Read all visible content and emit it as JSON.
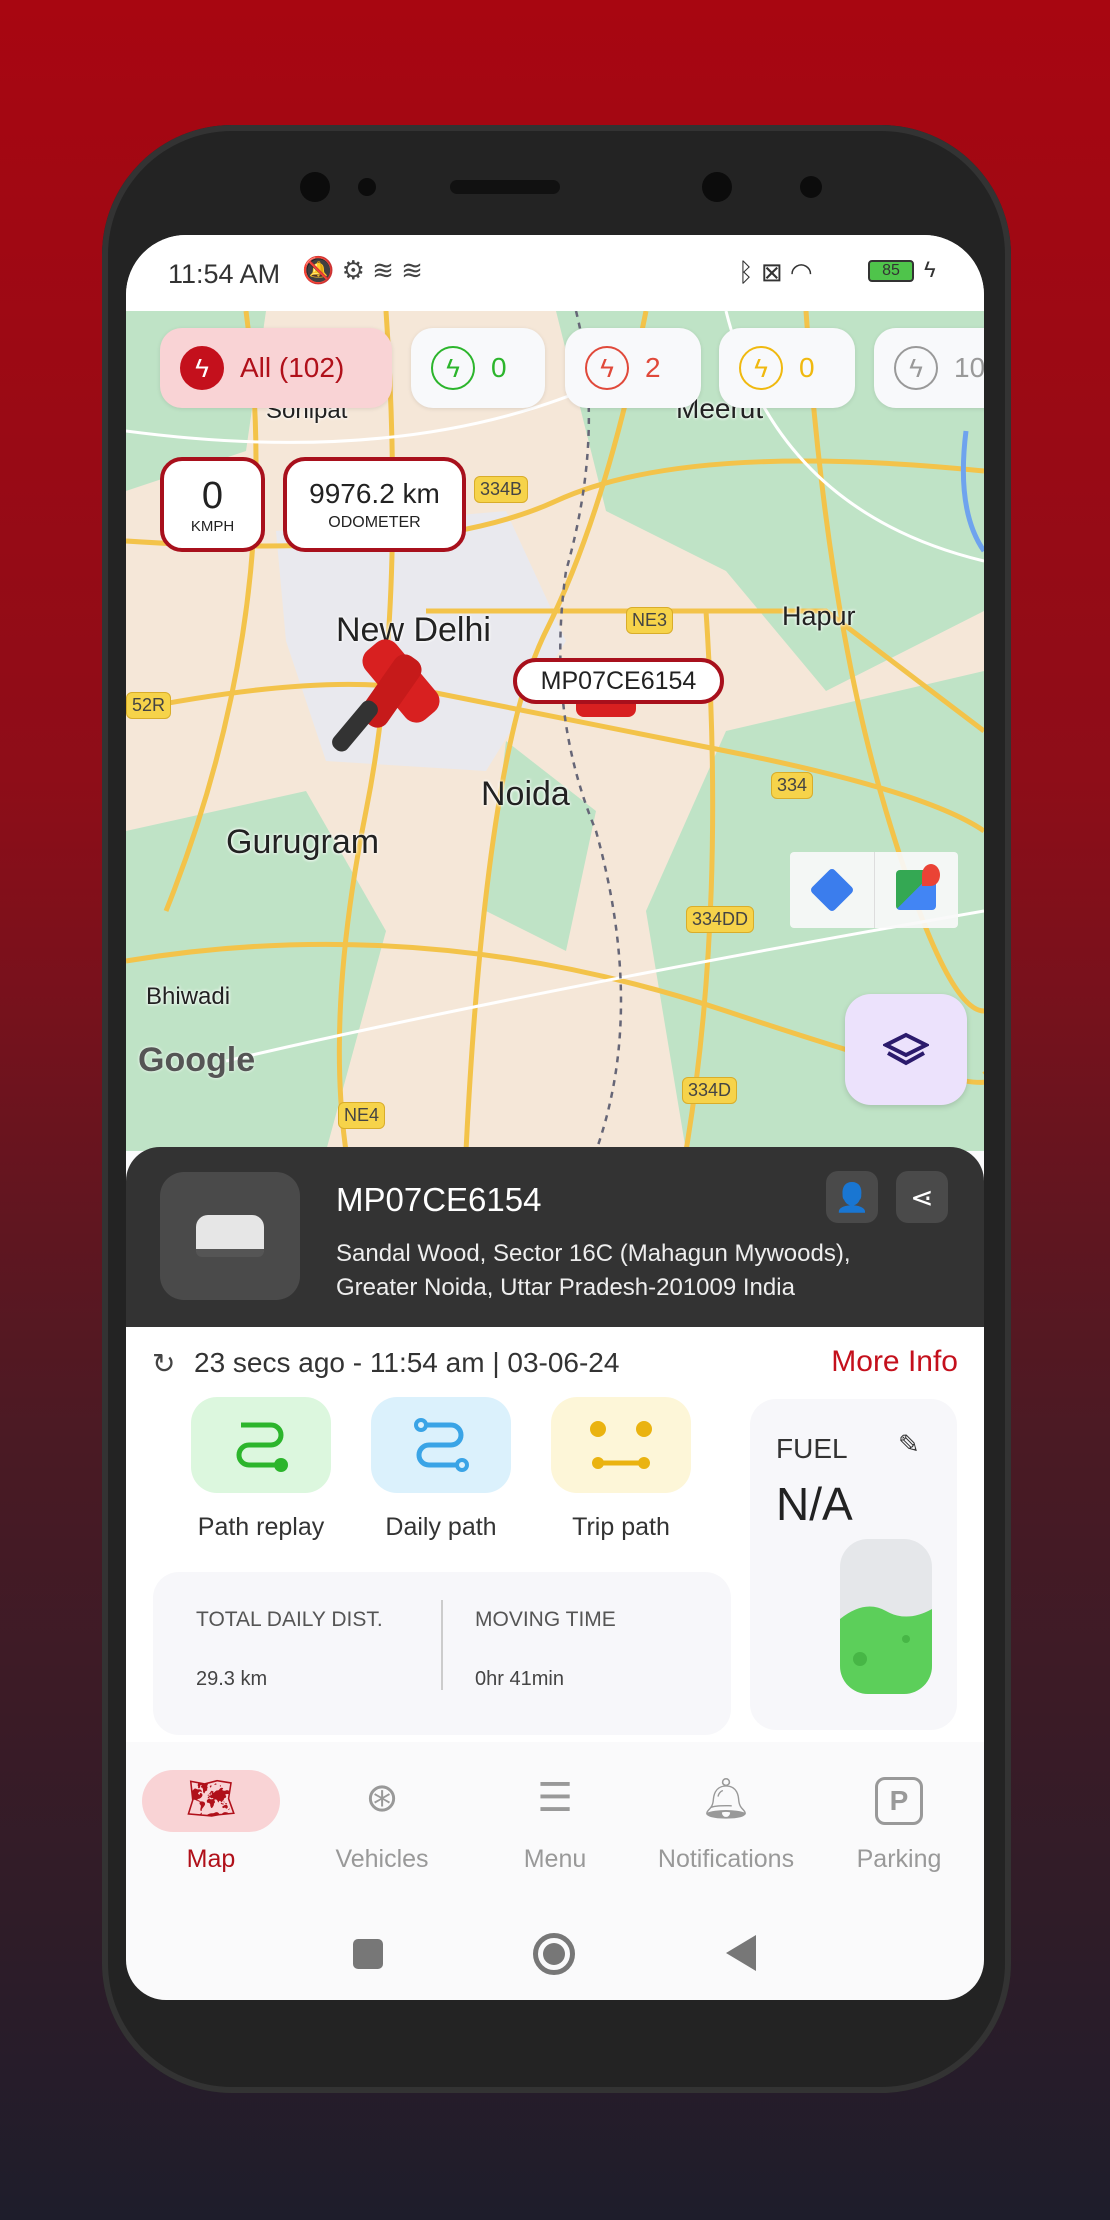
{
  "status_bar": {
    "time": "11:54 AM",
    "battery": "85"
  },
  "filters": [
    {
      "label": "All (102)",
      "color": "#c4101c",
      "active": true
    },
    {
      "label": "0",
      "color": "#2cb52c"
    },
    {
      "label": "2",
      "color": "#e0493a"
    },
    {
      "label": "0",
      "color": "#f0b90f"
    },
    {
      "label": "10",
      "color": "#999999"
    }
  ],
  "speed": {
    "value": "0",
    "unit": "KMPH"
  },
  "odometer": {
    "value": "9976.2 km",
    "label": "ODOMETER"
  },
  "map": {
    "places": [
      "Sonipat",
      "Meerut",
      "New Delhi",
      "Hapur",
      "Noida",
      "Gurugram",
      "Bhiwadi"
    ],
    "shields": [
      "334B",
      "NE3",
      "52R",
      "334",
      "334DD",
      "334D",
      "NE4"
    ],
    "vehicle_label": "MP07CE6154",
    "attribution": "Google"
  },
  "vehicle": {
    "plate": "MP07CE6154",
    "address_line1": "Sandal Wood, Sector 16C (Mahagun Mywoods),",
    "address_line2": "Greater Noida, Uttar Pradesh-201009 India"
  },
  "update": {
    "text": "23 secs ago - 11:54 am | 03-06-24",
    "more_info": "More Info"
  },
  "actions": [
    {
      "label": "Path replay"
    },
    {
      "label": "Daily path"
    },
    {
      "label": "Trip path"
    }
  ],
  "stats": {
    "dist_label": "TOTAL DAILY DIST.",
    "dist_value": "29.3 km",
    "time_label": "MOVING TIME",
    "time_value": "0hr 41min"
  },
  "fuel": {
    "label": "FUEL",
    "value": "N/A"
  },
  "bottom_nav": [
    {
      "label": "Map",
      "active": true
    },
    {
      "label": "Vehicles"
    },
    {
      "label": "Menu"
    },
    {
      "label": "Notifications"
    },
    {
      "label": "Parking"
    }
  ],
  "colors": {
    "brand": "#c4101c",
    "card": "#333333"
  }
}
